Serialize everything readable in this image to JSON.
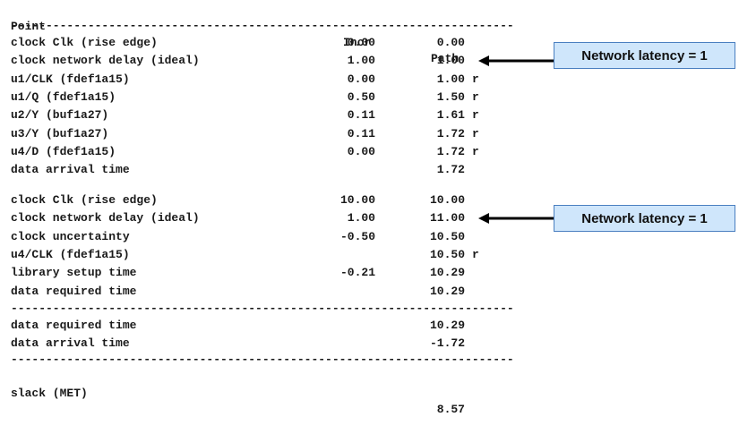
{
  "header": {
    "point": "Point",
    "incr": "Incr",
    "path": "Path"
  },
  "separator": "------------------------------------------------------------------------",
  "rows_a": [
    {
      "point": "clock Clk (rise edge)",
      "incr": "0.00",
      "path": "0.00",
      "flag": ""
    },
    {
      "point": "clock network delay (ideal)",
      "incr": "1.00",
      "path": "1.00",
      "flag": ""
    },
    {
      "point": "u1/CLK (fdef1a15)",
      "incr": "0.00",
      "path": "1.00",
      "flag": "r"
    },
    {
      "point": "u1/Q (fdef1a15)",
      "incr": "0.50",
      "path": "1.50",
      "flag": "r"
    },
    {
      "point": "u2/Y (buf1a27)",
      "incr": "0.11",
      "path": "1.61",
      "flag": "r"
    },
    {
      "point": "u3/Y (buf1a27)",
      "incr": "0.11",
      "path": "1.72",
      "flag": "r"
    },
    {
      "point": "u4/D (fdef1a15)",
      "incr": "0.00",
      "path": "1.72",
      "flag": "r"
    },
    {
      "point": "data arrival time",
      "incr": "",
      "path": "1.72",
      "flag": ""
    }
  ],
  "rows_b": [
    {
      "point": "clock Clk (rise edge)",
      "incr": "10.00",
      "path": "10.00",
      "flag": ""
    },
    {
      "point": "clock network delay (ideal)",
      "incr": "1.00",
      "path": "11.00",
      "flag": ""
    },
    {
      "point": "clock uncertainty",
      "incr": "-0.50",
      "path": "10.50",
      "flag": ""
    },
    {
      "point": "u4/CLK (fdef1a15)",
      "incr": "",
      "path": "10.50",
      "flag": "r"
    },
    {
      "point": "library setup time",
      "incr": "-0.21",
      "path": "10.29",
      "flag": ""
    },
    {
      "point": "data required time",
      "incr": "",
      "path": "10.29",
      "flag": ""
    }
  ],
  "rows_c": [
    {
      "point": "data required time",
      "incr": "",
      "path": "10.29",
      "flag": ""
    },
    {
      "point": "data arrival time",
      "incr": "",
      "path": "-1.72",
      "flag": ""
    }
  ],
  "slack": {
    "point": "slack (MET)",
    "path": "8.57"
  },
  "callouts": {
    "top": "Network latency = 1",
    "bottom": "Network latency = 1"
  }
}
